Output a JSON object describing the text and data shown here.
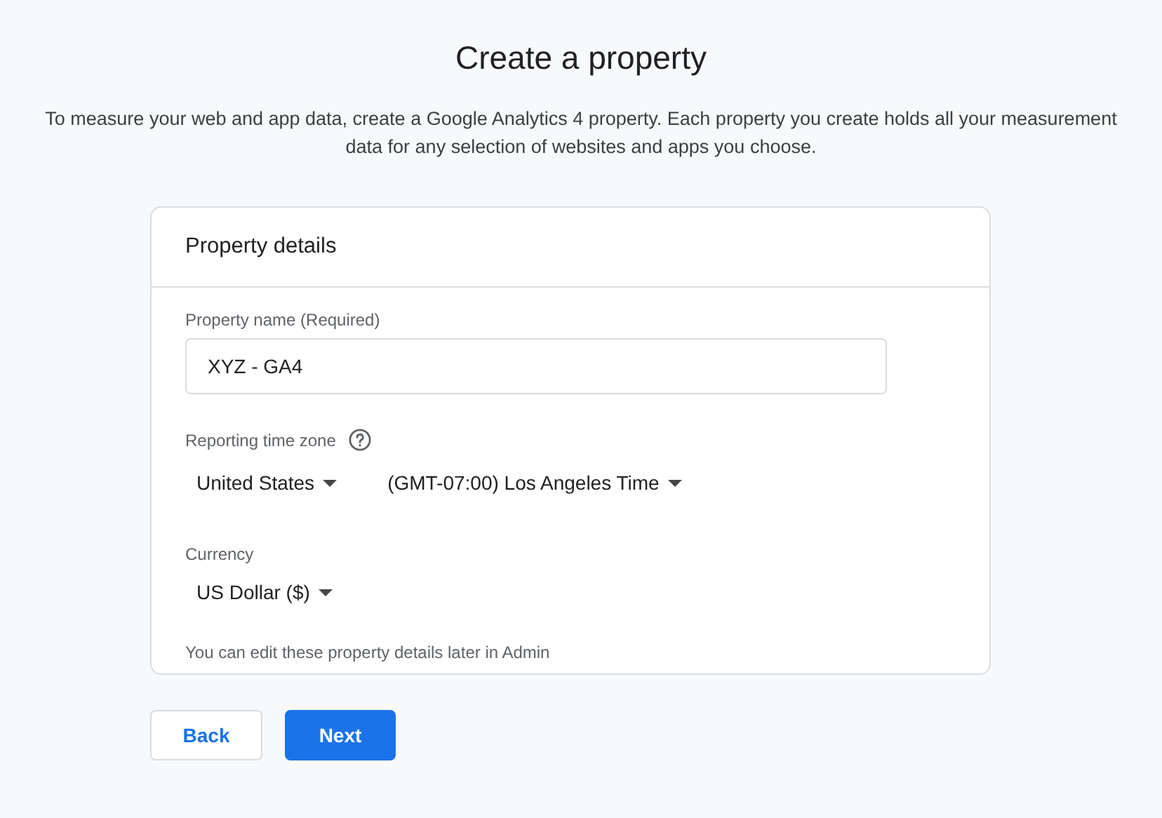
{
  "title": "Create a property",
  "intro": "To measure your web and app data, create a Google Analytics 4 property. Each property you create holds all your measurement data for any selection of websites and apps you choose.",
  "card": {
    "heading": "Property details",
    "property_name": {
      "label": "Property name (Required)",
      "value": "XYZ - GA4"
    },
    "time_zone": {
      "label": "Reporting time zone",
      "country": "United States",
      "zone": "(GMT-07:00) Los Angeles Time"
    },
    "currency": {
      "label": "Currency",
      "value": "US Dollar ($)"
    },
    "note": "You can edit these property details later in Admin"
  },
  "buttons": [
    {
      "label": "Back",
      "kind": "outlined"
    },
    {
      "label": "Next",
      "kind": "filled"
    }
  ]
}
